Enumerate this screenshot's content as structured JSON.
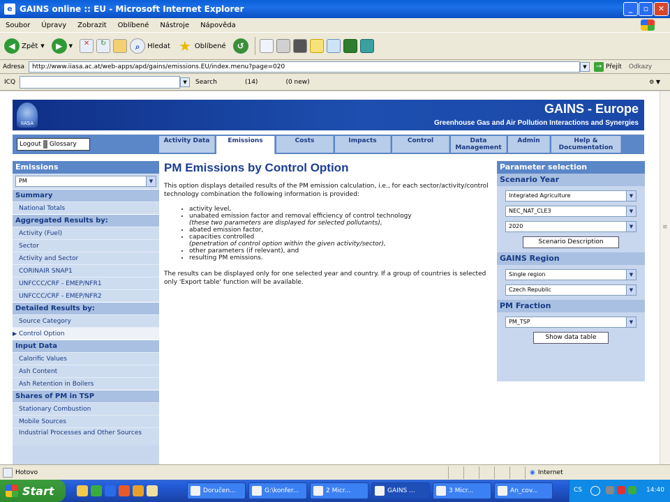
{
  "window": {
    "title": "GAINS online :: EU - Microsoft Internet Explorer"
  },
  "menu": [
    "Soubor",
    "Úpravy",
    "Zobrazit",
    "Oblíbené",
    "Nástroje",
    "Nápověda"
  ],
  "toolbar": {
    "back": "Zpět",
    "search": "Hledat",
    "favorites": "Oblíbené"
  },
  "address": {
    "label": "Adresa",
    "url": "http://www.iiasa.ac.at/web-apps/apd/gains/emissions.EU/index.menu?page=020",
    "go": "Přejít",
    "links": "Odkazy"
  },
  "linksbar": {
    "brand": "ICQ",
    "search": "Search",
    "count": "(14)",
    "mail": "(0 new)"
  },
  "site": {
    "logo_text": "IIASA",
    "title": "GAINS - Europe",
    "subtitle": "Greenhouse Gas and Air Pollution Interactions and Synergies",
    "logout": "Logout",
    "glossary": "Glossary",
    "tabs": [
      {
        "label": "Activity Data",
        "active": false
      },
      {
        "label": "Emissions",
        "active": true
      },
      {
        "label": "Costs",
        "active": false
      },
      {
        "label": "Impacts",
        "active": false
      },
      {
        "label": "Control",
        "active": false
      },
      {
        "label": "Data Management",
        "active": false
      },
      {
        "label": "Admin",
        "active": false
      },
      {
        "label": "Help & Documentation",
        "active": false
      }
    ]
  },
  "sidebar": {
    "header": "Emissions",
    "pollutant": "PM",
    "summary": "Summary",
    "summary_items": [
      "National Totals"
    ],
    "aggregated": "Aggregated Results by:",
    "aggregated_items": [
      "Activity (Fuel)",
      "Sector",
      "Activity and Sector",
      "CORINAIR SNAP1",
      "UNFCCC/CRF - EMEP/NFR1",
      "UNFCCC/CRF - EMEP/NFR2"
    ],
    "detailed": "Detailed Results by:",
    "detailed_items": [
      "Source Category",
      "Control Option"
    ],
    "input": "Input Data",
    "input_items": [
      "Calorific Values",
      "Ash Content",
      "Ash Retention in Boilers"
    ],
    "shares": "Shares of PM in TSP",
    "shares_items": [
      "Stationary Combustion",
      "Mobile Sources",
      "Industrial Processes and Other Sources"
    ]
  },
  "main": {
    "title": "PM Emissions by Control Option",
    "intro": "This option displays detailed results of the PM emission calculation, i.e., for each sector/activity/control technology combination the following information is provided:",
    "bullets": [
      {
        "text": "activity level,",
        "note": ""
      },
      {
        "text": "unabated emission factor and removal efficiency of control technology",
        "note": "(these two parameters are displayed for selected pollutants),"
      },
      {
        "text": "abated emission factor,",
        "note": ""
      },
      {
        "text": "capacities controlled",
        "note": "(penetration of control option within the given activity/sector),"
      },
      {
        "text": "other parameters (if relevant), and",
        "note": ""
      },
      {
        "text": "resulting PM emissions.",
        "note": ""
      }
    ],
    "footnote": "The results can be displayed only for one selected year and country. If a group of countries is selected only 'Export table' function will be available."
  },
  "params": {
    "header": "Parameter selection",
    "scenario_year": "Scenario Year",
    "scenario": "Integrated Agriculture",
    "dataset": "NEC_NAT_CLE3",
    "year": "2020",
    "scenario_button": "Scenario Description",
    "region_header": "GAINS Region",
    "region_mode": "Single region",
    "region": "Czech Republic",
    "fraction_header": "PM Fraction",
    "fraction": "PM_TSP",
    "show_button": "Show data table"
  },
  "status": {
    "text": "Hotovo",
    "zone": "Internet"
  },
  "taskbar": {
    "start": "Start",
    "tasks": [
      "Doručen...",
      "G:\\konfer...",
      "2 Micr...",
      "GAINS ...",
      "3 Micr...",
      "An_cov..."
    ],
    "tray_lang": "CS",
    "clock": "14:40"
  },
  "colors": {
    "header": "#1d4fb0",
    "nav": "#5b86c7",
    "title": "#1b3d93",
    "sidebar": "#c8d7ee"
  }
}
